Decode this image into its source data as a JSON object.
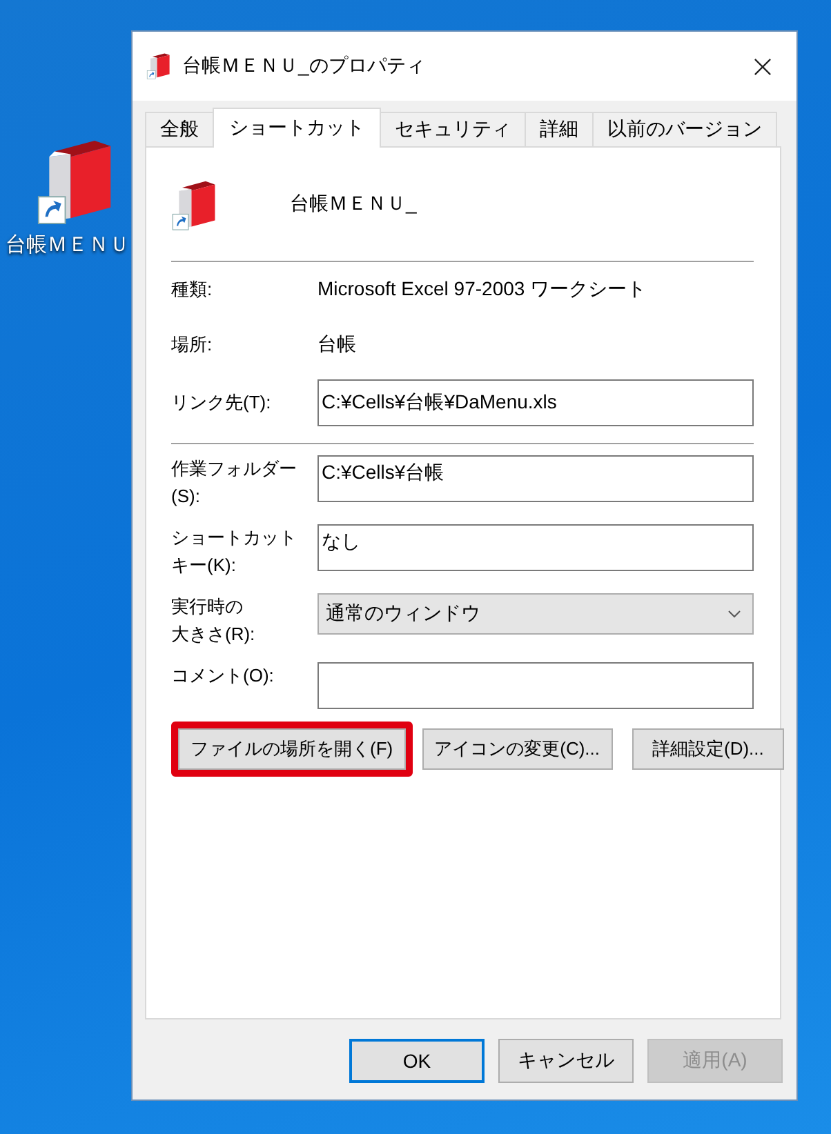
{
  "desktop_icon": {
    "label": "台帳ＭＥＮＵ"
  },
  "window": {
    "title": "台帳ＭＥＮＵ_のプロパティ"
  },
  "tabs": [
    {
      "label": "全般",
      "selected": false
    },
    {
      "label": "ショートカット",
      "selected": true
    },
    {
      "label": "セキュリティ",
      "selected": false
    },
    {
      "label": "詳細",
      "selected": false
    },
    {
      "label": "以前のバージョン",
      "selected": false
    }
  ],
  "header": {
    "name": "台帳ＭＥＮＵ_"
  },
  "info_rows": [
    {
      "label": "種類:",
      "value": "Microsoft Excel 97-2003 ワークシート"
    },
    {
      "label": "場所:",
      "value": "台帳"
    }
  ],
  "target": {
    "label": "リンク先(T):",
    "value": "C:¥Cells¥台帳¥DaMenu.xls"
  },
  "fields": [
    {
      "kind": "text",
      "label_lines": [
        "作業フォルダー",
        "(S):"
      ],
      "value": "C:¥Cells¥台帳"
    },
    {
      "kind": "text",
      "label_lines": [
        "ショートカット",
        "キー(K):"
      ],
      "value": "なし"
    },
    {
      "kind": "select",
      "label_lines": [
        "実行時の",
        "大きさ(R):"
      ],
      "value": "通常のウィンドウ"
    },
    {
      "kind": "text",
      "label_lines": [
        "コメント(O):"
      ]
    }
  ],
  "action_buttons": [
    {
      "label": "ファイルの場所を開く(F)",
      "highlighted": true
    },
    {
      "label": "アイコンの変更(C)...",
      "highlighted": false
    },
    {
      "label": "詳細設定(D)...",
      "highlighted": false
    }
  ],
  "dialog_buttons": [
    {
      "label": "OK",
      "focused": true,
      "disabled": false
    },
    {
      "label": "キャンセル",
      "focused": false,
      "disabled": false
    },
    {
      "label": "適用(A)",
      "focused": false,
      "disabled": true
    }
  ]
}
